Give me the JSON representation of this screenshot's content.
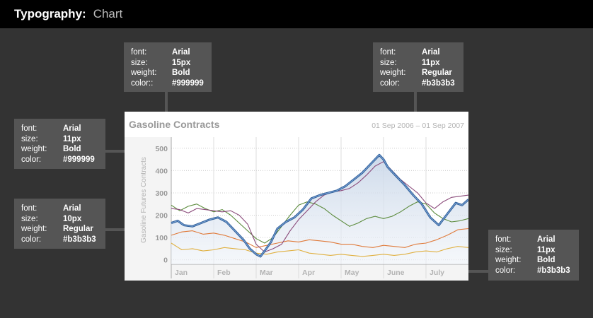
{
  "header": {
    "title": "Typography:",
    "subtitle": "Chart"
  },
  "specs": {
    "title": {
      "font_label": "font:",
      "font": "Arial",
      "size_label": "size:",
      "size": "15px",
      "weight_label": "weight:",
      "weight": "Bold",
      "color_label": "color::",
      "color": "#999999"
    },
    "date": {
      "font_label": "font:",
      "font": "Arial",
      "size_label": "size:",
      "size": "11px",
      "weight_label": "weight:",
      "weight": "Regular",
      "color_label": "color:",
      "color": "#b3b3b3"
    },
    "ytick": {
      "font_label": "font:",
      "font": "Arial",
      "size_label": "size:",
      "size": "11px",
      "weight_label": "weight:",
      "weight": "Bold",
      "color_label": "color:",
      "color": "#999999"
    },
    "ylabel": {
      "font_label": "font:",
      "font": "Arial",
      "size_label": "size:",
      "size": "10px",
      "weight_label": "weight:",
      "weight": "Regular",
      "color_label": "color:",
      "color": "#b3b3b3"
    },
    "xtick": {
      "font_label": "font:",
      "font": "Arial",
      "size_label": "size:",
      "size": "11px",
      "weight_label": "weight:",
      "weight": "Bold",
      "color_label": "color:",
      "color": "#b3b3b3"
    }
  },
  "chart_data": {
    "type": "line",
    "title": "Gasoline Contracts",
    "date_range": "01 Sep 2006 – 01 Sep 2007",
    "ylabel": "Gasoline Futures Contracts",
    "xlabel": "",
    "categories": [
      "Jan",
      "Feb",
      "Mar",
      "Apr",
      "May",
      "June",
      "July"
    ],
    "yticks": [
      0,
      100,
      200,
      300,
      400,
      500
    ],
    "ylim": [
      -20,
      550
    ],
    "xlim": [
      0,
      7
    ],
    "grid": true,
    "legend": "none",
    "series": [
      {
        "color": "#4a7fbf",
        "fill": true,
        "x": [
          0,
          0.15,
          0.3,
          0.5,
          0.7,
          0.9,
          1.1,
          1.3,
          1.5,
          1.7,
          1.85,
          2.0,
          2.1,
          2.2,
          2.35,
          2.5,
          2.7,
          2.9,
          3.1,
          3.3,
          3.5,
          3.7,
          3.9,
          4.1,
          4.3,
          4.5,
          4.7,
          4.9,
          5.0,
          5.1,
          5.3,
          5.5,
          5.7,
          5.9,
          6.1,
          6.3,
          6.5,
          6.7,
          6.85,
          7.0
        ],
        "y": [
          165,
          175,
          155,
          150,
          165,
          180,
          190,
          170,
          130,
          90,
          50,
          25,
          15,
          40,
          80,
          140,
          170,
          190,
          225,
          275,
          290,
          300,
          310,
          330,
          360,
          390,
          430,
          470,
          450,
          415,
          375,
          335,
          290,
          250,
          190,
          155,
          205,
          255,
          245,
          270
        ]
      },
      {
        "color": "#8a4a7a",
        "fill": false,
        "x": [
          0,
          0.2,
          0.4,
          0.6,
          0.8,
          1.0,
          1.2,
          1.4,
          1.6,
          1.8,
          2.0,
          2.2,
          2.4,
          2.6,
          2.8,
          3.0,
          3.2,
          3.4,
          3.6,
          3.8,
          4.0,
          4.2,
          4.4,
          4.6,
          4.8,
          5.0,
          5.2,
          5.4,
          5.6,
          5.8,
          6.0,
          6.2,
          6.4,
          6.6,
          6.8,
          7.0
        ],
        "y": [
          230,
          225,
          210,
          230,
          225,
          220,
          215,
          220,
          200,
          160,
          70,
          35,
          50,
          70,
          130,
          180,
          220,
          260,
          290,
          305,
          310,
          320,
          345,
          380,
          420,
          440,
          400,
          360,
          330,
          300,
          255,
          230,
          260,
          280,
          285,
          290
        ]
      },
      {
        "color": "#5a8a3a",
        "fill": false,
        "x": [
          0,
          0.2,
          0.4,
          0.6,
          0.8,
          1.0,
          1.2,
          1.4,
          1.6,
          1.8,
          2.0,
          2.2,
          2.4,
          2.6,
          2.8,
          3.0,
          3.2,
          3.4,
          3.6,
          3.8,
          4.0,
          4.2,
          4.4,
          4.6,
          4.8,
          5.0,
          5.2,
          5.4,
          5.6,
          5.8,
          6.0,
          6.2,
          6.4,
          6.6,
          6.8,
          7.0
        ],
        "y": [
          245,
          220,
          240,
          250,
          230,
          215,
          225,
          200,
          165,
          130,
          95,
          75,
          100,
          150,
          200,
          245,
          260,
          250,
          230,
          200,
          175,
          150,
          165,
          185,
          195,
          185,
          195,
          215,
          240,
          260,
          250,
          210,
          185,
          170,
          175,
          185
        ]
      },
      {
        "color": "#e07a3a",
        "fill": false,
        "x": [
          0,
          0.25,
          0.5,
          0.75,
          1.0,
          1.25,
          1.5,
          1.75,
          2.0,
          2.25,
          2.5,
          2.75,
          3.0,
          3.25,
          3.5,
          3.75,
          4.0,
          4.25,
          4.5,
          4.75,
          5.0,
          5.25,
          5.5,
          5.75,
          6.0,
          6.25,
          6.5,
          6.75,
          7.0
        ],
        "y": [
          110,
          125,
          130,
          115,
          120,
          110,
          95,
          80,
          55,
          65,
          75,
          85,
          80,
          90,
          85,
          80,
          70,
          70,
          60,
          55,
          65,
          60,
          55,
          70,
          75,
          90,
          110,
          135,
          140
        ]
      },
      {
        "color": "#e0b040",
        "fill": false,
        "x": [
          0,
          0.25,
          0.5,
          0.75,
          1.0,
          1.25,
          1.5,
          1.75,
          2.0,
          2.25,
          2.5,
          2.75,
          3.0,
          3.25,
          3.5,
          3.75,
          4.0,
          4.25,
          4.5,
          4.75,
          5.0,
          5.25,
          5.5,
          5.75,
          6.0,
          6.25,
          6.5,
          6.75,
          7.0
        ],
        "y": [
          75,
          45,
          50,
          40,
          45,
          55,
          50,
          45,
          30,
          25,
          35,
          40,
          45,
          30,
          25,
          20,
          25,
          20,
          15,
          20,
          25,
          20,
          25,
          35,
          40,
          35,
          50,
          60,
          55
        ]
      }
    ]
  }
}
